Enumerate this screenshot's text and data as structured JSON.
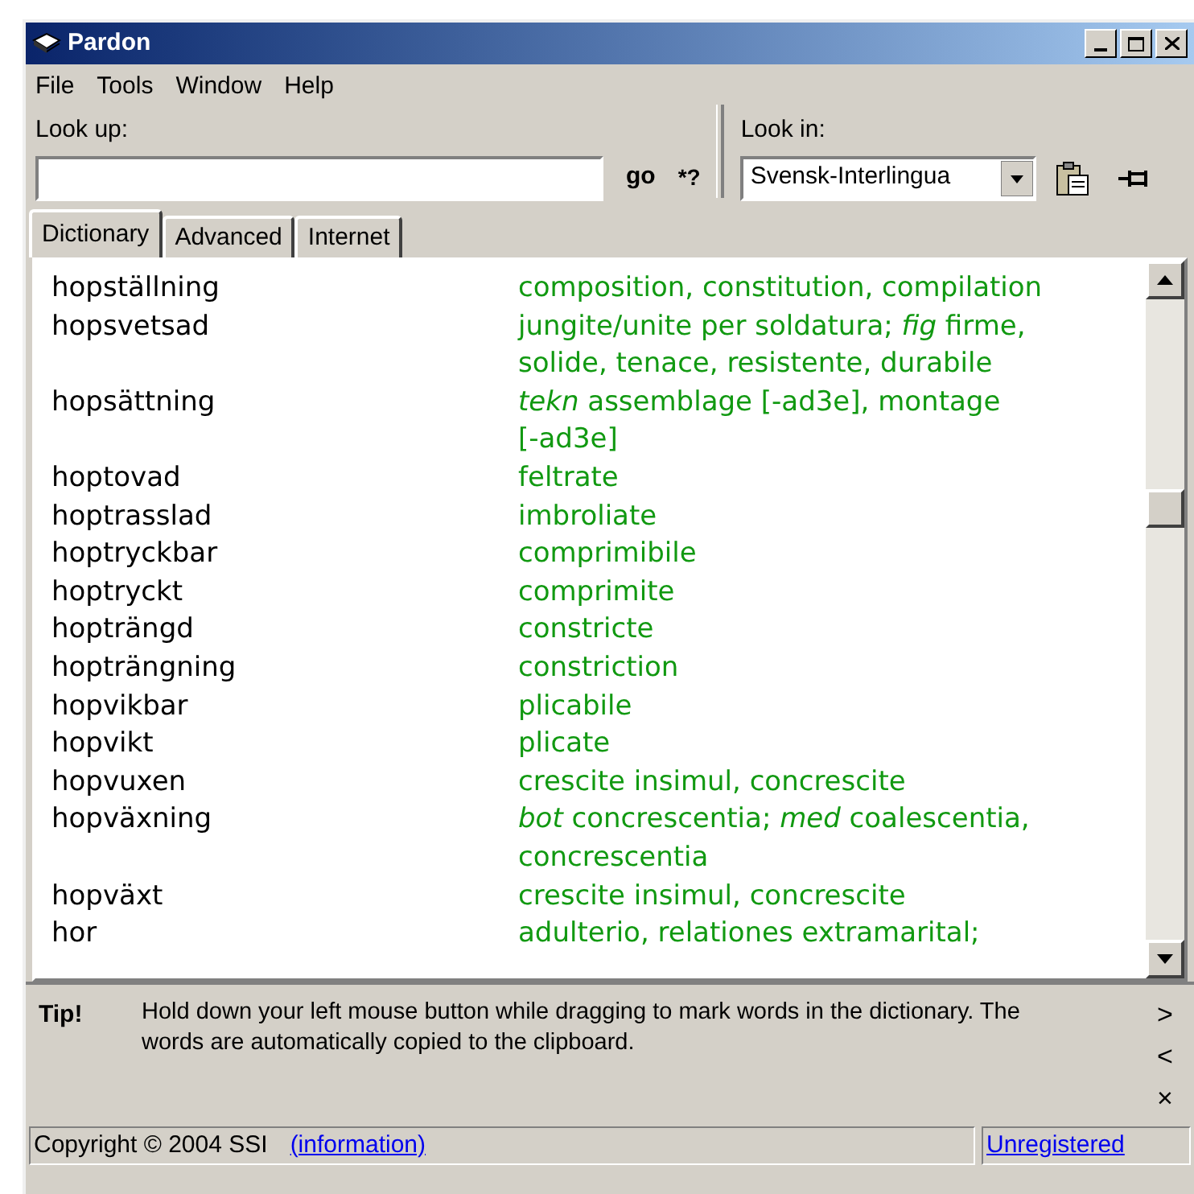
{
  "window": {
    "title": "Pardon"
  },
  "menu": [
    "File",
    "Tools",
    "Window",
    "Help"
  ],
  "lookup": {
    "label": "Look up:",
    "go": "go",
    "wildcard": "*?"
  },
  "lookin": {
    "label": "Look in:",
    "value": "Svensk-Interlingua"
  },
  "tabs": [
    {
      "label": "Dictionary",
      "selected": true
    },
    {
      "label": "Advanced",
      "selected": false
    },
    {
      "label": "Internet",
      "selected": false
    }
  ],
  "entries": [
    {
      "word": "hopställning",
      "lines": [
        "composition, constitution, compilation"
      ]
    },
    {
      "word": "hopsvetsad",
      "lines": [
        "jungite/unite per soldatura; *fig* firme,",
        "solide, tenace, resistente, durabile"
      ]
    },
    {
      "word": "hopsättning",
      "lines": [
        "*tekn* assemblage [-ad3e], montage",
        "[-ad3e]"
      ]
    },
    {
      "word": "hoptovad",
      "lines": [
        "feltrate"
      ]
    },
    {
      "word": "hoptrasslad",
      "lines": [
        "imbroliate"
      ]
    },
    {
      "word": "hoptryckbar",
      "lines": [
        "comprimibile"
      ]
    },
    {
      "word": "hoptryckt",
      "lines": [
        "comprimite"
      ]
    },
    {
      "word": "hopträngd",
      "lines": [
        "constricte"
      ]
    },
    {
      "word": "hopträngning",
      "lines": [
        "constriction"
      ]
    },
    {
      "word": "hopvikbar",
      "lines": [
        "plicabile"
      ]
    },
    {
      "word": "hopvikt",
      "lines": [
        "plicate"
      ]
    },
    {
      "word": "hopvuxen",
      "lines": [
        "crescite insimul, concrescite"
      ]
    },
    {
      "word": "hopväxning",
      "lines": [
        "*bot* concrescentia; *med* coalescentia,",
        "concrescentia"
      ]
    },
    {
      "word": "hopväxt",
      "lines": [
        "crescite insimul, concrescite"
      ]
    },
    {
      "word": "hor",
      "lines": [
        "adulterio, relationes extramarital;"
      ]
    }
  ],
  "tip": {
    "label": "Tip!",
    "text": "Hold down your left mouse button while dragging to mark words in the dictionary. The words are automatically copied to the clipboard.",
    "next": ">",
    "prev": "<",
    "close": "×"
  },
  "status_bar": {
    "copyright": "Copyright © 2004 SSI",
    "info_link": "(information)",
    "registration": "Unregistered"
  }
}
